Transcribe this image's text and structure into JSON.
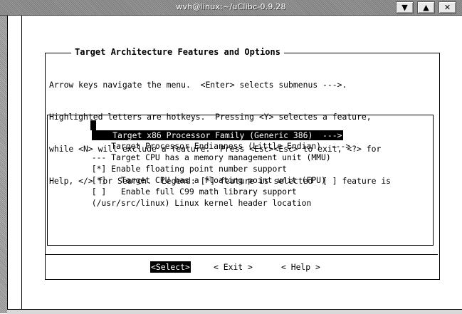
{
  "window": {
    "title": "wvh@linux:~/uClibc-0.9.28",
    "buttons": [
      "▼",
      "▲",
      "✕"
    ]
  },
  "dialog": {
    "title": "Target Architecture Features and Options",
    "help_lines": [
      "Arrow keys navigate the menu.  <Enter> selects submenus --->.",
      "Highlighted letters are hotkeys.  Pressing <Y> selectes a feature,",
      "while <N> will exclude a feature.  Press <Esc><Esc> to exit, <?> for",
      "Help, </> for Search.  Legend: [*] feature is selected  [ ] feature is"
    ]
  },
  "menu": {
    "items": [
      "    Target x86 Processor Family (Generic 386)  --->",
      "    Target Processor Endianness (Little Endian)  --->",
      "--- Target CPU has a memory management unit (MMU)",
      "[*] Enable floating point number support",
      "[*]   Target CPU has a floating point unit (FPU)",
      "[ ]   Enable full C99 math library support",
      "(/usr/src/linux) Linux kernel header location"
    ]
  },
  "buttons": {
    "select": "<Select>",
    "exit": "< Exit >",
    "help": "< Help >"
  }
}
